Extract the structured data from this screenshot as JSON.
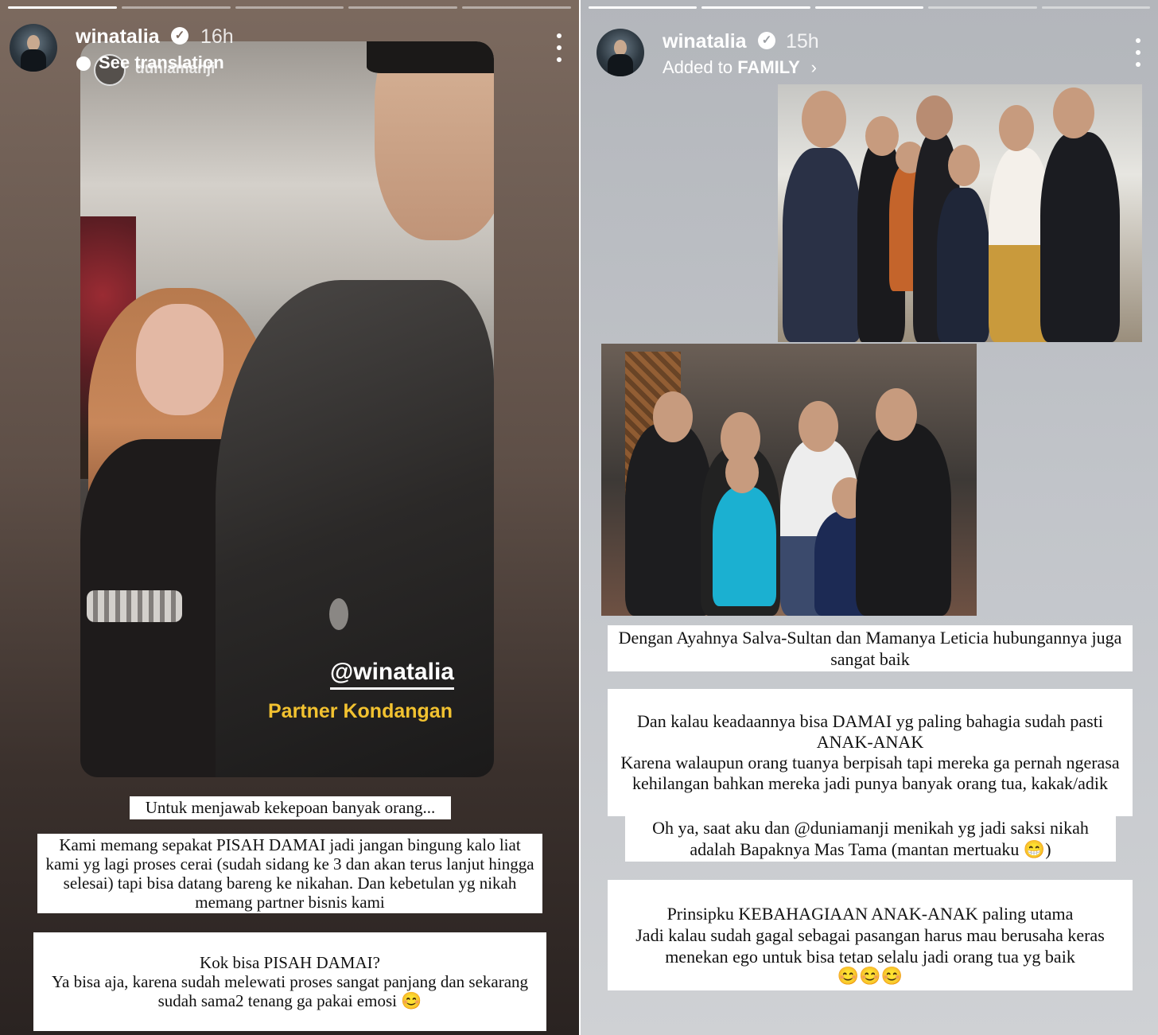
{
  "left_story": {
    "username": "winatalia",
    "verified": true,
    "time": "16h",
    "see_translation": "See translation",
    "reposted_from": "duniamanji",
    "watermark": "@winatalia",
    "watermark_sub": "Partner Kondangan",
    "progress_segments": 5,
    "text_boxes": [
      "Untuk menjawab kekepoan banyak orang...",
      "Kami memang sepakat PISAH DAMAI jadi jangan bingung kalo liat kami yg lagi proses cerai (sudah sidang ke  3 dan akan terus lanjut hingga selesai) tapi bisa datang bareng ke nikahan. Dan kebetulan yg nikah memang partner bisnis kami",
      "Kok bisa PISAH DAMAI?\nYa bisa aja, karena sudah melewati proses sangat panjang dan sekarang sudah sama2 tenang ga pakai emosi 😊"
    ]
  },
  "right_story": {
    "username": "winatalia",
    "verified": true,
    "time": "15h",
    "added_to_prefix": "Added to",
    "added_to_highlight": "FAMILY",
    "progress_segments": 5,
    "text_boxes": [
      "Dengan Ayahnya Salva-Sultan dan Mamanya Leticia hubungannya juga sangat baik",
      "Dan kalau keadaannya bisa DAMAI yg paling bahagia sudah pasti ANAK-ANAK\nKarena walaupun orang tuanya berpisah tapi mereka ga pernah ngerasa kehilangan bahkan mereka jadi punya banyak orang tua, kakak/adik",
      "Oh ya, saat aku dan @duniamanji menikah yg jadi saksi nikah adalah Bapaknya Mas Tama (mantan mertuaku 😁)",
      "Prinsipku KEBAHAGIAAN ANAK-ANAK paling utama\nJadi kalau sudah gagal sebagai pasangan harus mau berusaha keras menekan ego untuk bisa tetap selalu jadi orang tua yg baik",
      "😊😊😊"
    ],
    "mention": "@duniamanji"
  },
  "icons": {
    "verified": "verified-badge-icon",
    "more": "more-options-icon",
    "chevron": "chevron-right-icon",
    "translate": "translate-bubble-icon"
  }
}
